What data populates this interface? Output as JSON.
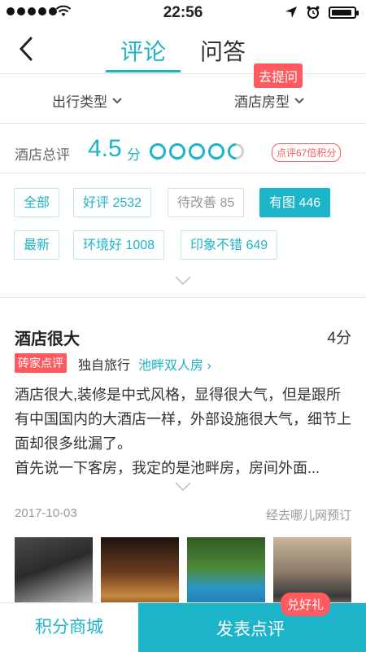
{
  "status_bar": {
    "time": "22:56",
    "signal_icon": "signal-dots-icon",
    "wifi_icon": "wifi-icon",
    "location_icon": "location-arrow-icon",
    "alarm_icon": "alarm-clock-icon",
    "battery_icon": "battery-icon",
    "battery_level": 0.85
  },
  "nav": {
    "back_icon": "back-chevron-icon",
    "tab_review": "评论",
    "tab_qa": "问答",
    "ask_button": "去提问"
  },
  "filters": {
    "trip_type": "出行类型",
    "room_type": "酒店房型",
    "dropdown_icon": "chevron-down-icon"
  },
  "overall": {
    "label": "酒店总评",
    "score": "4.5",
    "unit": "分",
    "rating_value": 4.5,
    "rating_max": 5,
    "points_badge": "点评67倍积分"
  },
  "tags": {
    "all": "全部",
    "good": "好评 2532",
    "to_improve": "待改善 85",
    "with_photos": "有图 446",
    "latest": "最新",
    "good_environment": "环境好 1008",
    "good_impression": "印象不错 649",
    "active_tag": "有图 446"
  },
  "review": {
    "title": "酒店很大",
    "score": "4分",
    "badge": "砖家点评",
    "trip_type": "独自旅行",
    "room": "池畔双人房 ›",
    "body": "酒店很大,装修是中式风格，显得很大气，但是跟所有中国国内的大酒店一样，外部设施很大气，细节上面却很多纰漏了。\n首先说一下客房，我定的是池畔房，房间外面...",
    "date": "2017-10-03",
    "source": "经去哪儿网预订"
  },
  "bottom": {
    "mall": "积分商城",
    "post": "发表点评",
    "gift_badge": "兑好礼"
  },
  "colors": {
    "accent": "#1cb4c8",
    "alert": "#ff5a5f"
  }
}
